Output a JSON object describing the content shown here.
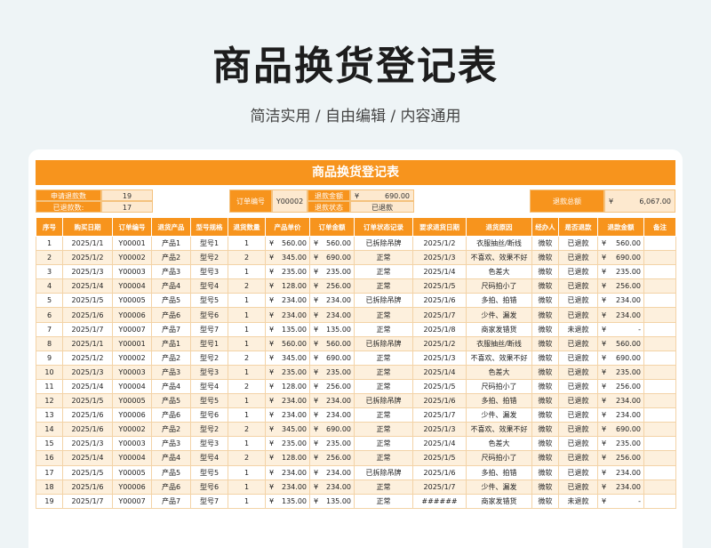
{
  "hero": {
    "title": "商品换货登记表",
    "subtitle": "简洁实用 / 自由编辑 / 内容通用"
  },
  "sheet": {
    "title": "商品换货登记表",
    "summary": {
      "refund_count_label": "申请退款数",
      "refund_count_value": "19",
      "refunded_label": "已退款数:",
      "refunded_value": "17",
      "order_no_label": "订单编号",
      "order_no_value": "Y00002",
      "refund_amount_label": "退款金额",
      "refund_amount_currency": "¥",
      "refund_amount_value": "690.00",
      "refund_status_label": "退款状态",
      "refund_status_value": "已退款",
      "total_label": "退款总额",
      "total_currency": "¥",
      "total_value": "6,067.00"
    },
    "columns": [
      "序号",
      "购买日期",
      "订单编号",
      "退货产品",
      "型号规格",
      "退货数量",
      "产品单价",
      "订单金额",
      "订单状态记录",
      "要求退货日期",
      "退货原因",
      "经办人",
      "是否退款",
      "退款金额",
      "备注"
    ],
    "rows": [
      [
        "1",
        "2025/1/1",
        "Y00001",
        "产品1",
        "型号1",
        "1",
        "¥",
        "560.00",
        "¥",
        "560.00",
        "已拆除吊牌",
        "2025/1/2",
        "衣服抽丝/断线",
        "微软",
        "已退款",
        "¥",
        "560.00",
        ""
      ],
      [
        "2",
        "2025/1/2",
        "Y00002",
        "产品2",
        "型号2",
        "2",
        "¥",
        "345.00",
        "¥",
        "690.00",
        "正常",
        "2025/1/3",
        "不喜欢、效果不好",
        "微软",
        "已退款",
        "¥",
        "690.00",
        ""
      ],
      [
        "3",
        "2025/1/3",
        "Y00003",
        "产品3",
        "型号3",
        "1",
        "¥",
        "235.00",
        "¥",
        "235.00",
        "正常",
        "2025/1/4",
        "色差大",
        "微软",
        "已退款",
        "¥",
        "235.00",
        ""
      ],
      [
        "4",
        "2025/1/4",
        "Y00004",
        "产品4",
        "型号4",
        "2",
        "¥",
        "128.00",
        "¥",
        "256.00",
        "正常",
        "2025/1/5",
        "尺码拍小了",
        "微软",
        "已退款",
        "¥",
        "256.00",
        ""
      ],
      [
        "5",
        "2025/1/5",
        "Y00005",
        "产品5",
        "型号5",
        "1",
        "¥",
        "234.00",
        "¥",
        "234.00",
        "已拆除吊牌",
        "2025/1/6",
        "多拍、拍错",
        "微软",
        "已退款",
        "¥",
        "234.00",
        ""
      ],
      [
        "6",
        "2025/1/6",
        "Y00006",
        "产品6",
        "型号6",
        "1",
        "¥",
        "234.00",
        "¥",
        "234.00",
        "正常",
        "2025/1/7",
        "少件、漏发",
        "微软",
        "已退款",
        "¥",
        "234.00",
        ""
      ],
      [
        "7",
        "2025/1/7",
        "Y00007",
        "产品7",
        "型号7",
        "1",
        "¥",
        "135.00",
        "¥",
        "135.00",
        "正常",
        "2025/1/8",
        "商家发错货",
        "微软",
        "未退款",
        "¥",
        "-",
        ""
      ],
      [
        "8",
        "2025/1/1",
        "Y00001",
        "产品1",
        "型号1",
        "1",
        "¥",
        "560.00",
        "¥",
        "560.00",
        "已拆除吊牌",
        "2025/1/2",
        "衣服抽丝/断线",
        "微软",
        "已退款",
        "¥",
        "560.00",
        ""
      ],
      [
        "9",
        "2025/1/2",
        "Y00002",
        "产品2",
        "型号2",
        "2",
        "¥",
        "345.00",
        "¥",
        "690.00",
        "正常",
        "2025/1/3",
        "不喜欢、效果不好",
        "微软",
        "已退款",
        "¥",
        "690.00",
        ""
      ],
      [
        "10",
        "2025/1/3",
        "Y00003",
        "产品3",
        "型号3",
        "1",
        "¥",
        "235.00",
        "¥",
        "235.00",
        "正常",
        "2025/1/4",
        "色差大",
        "微软",
        "已退款",
        "¥",
        "235.00",
        ""
      ],
      [
        "11",
        "2025/1/4",
        "Y00004",
        "产品4",
        "型号4",
        "2",
        "¥",
        "128.00",
        "¥",
        "256.00",
        "正常",
        "2025/1/5",
        "尺码拍小了",
        "微软",
        "已退款",
        "¥",
        "256.00",
        ""
      ],
      [
        "12",
        "2025/1/5",
        "Y00005",
        "产品5",
        "型号5",
        "1",
        "¥",
        "234.00",
        "¥",
        "234.00",
        "已拆除吊牌",
        "2025/1/6",
        "多拍、拍错",
        "微软",
        "已退款",
        "¥",
        "234.00",
        ""
      ],
      [
        "13",
        "2025/1/6",
        "Y00006",
        "产品6",
        "型号6",
        "1",
        "¥",
        "234.00",
        "¥",
        "234.00",
        "正常",
        "2025/1/7",
        "少件、漏发",
        "微软",
        "已退款",
        "¥",
        "234.00",
        ""
      ],
      [
        "14",
        "2025/1/6",
        "Y00002",
        "产品2",
        "型号2",
        "2",
        "¥",
        "345.00",
        "¥",
        "690.00",
        "正常",
        "2025/1/3",
        "不喜欢、效果不好",
        "微软",
        "已退款",
        "¥",
        "690.00",
        ""
      ],
      [
        "15",
        "2025/1/3",
        "Y00003",
        "产品3",
        "型号3",
        "1",
        "¥",
        "235.00",
        "¥",
        "235.00",
        "正常",
        "2025/1/4",
        "色差大",
        "微软",
        "已退款",
        "¥",
        "235.00",
        ""
      ],
      [
        "16",
        "2025/1/4",
        "Y00004",
        "产品4",
        "型号4",
        "2",
        "¥",
        "128.00",
        "¥",
        "256.00",
        "正常",
        "2025/1/5",
        "尺码拍小了",
        "微软",
        "已退款",
        "¥",
        "256.00",
        ""
      ],
      [
        "17",
        "2025/1/5",
        "Y00005",
        "产品5",
        "型号5",
        "1",
        "¥",
        "234.00",
        "¥",
        "234.00",
        "已拆除吊牌",
        "2025/1/6",
        "多拍、拍错",
        "微软",
        "已退款",
        "¥",
        "234.00",
        ""
      ],
      [
        "18",
        "2025/1/6",
        "Y00006",
        "产品6",
        "型号6",
        "1",
        "¥",
        "234.00",
        "¥",
        "234.00",
        "正常",
        "2025/1/7",
        "少件、漏发",
        "微软",
        "已退款",
        "¥",
        "234.00",
        ""
      ],
      [
        "19",
        "2025/1/7",
        "Y00007",
        "产品7",
        "型号7",
        "1",
        "¥",
        "135.00",
        "¥",
        "135.00",
        "正常",
        "######",
        "商家发错货",
        "微软",
        "未退款",
        "¥",
        "-",
        ""
      ]
    ]
  }
}
